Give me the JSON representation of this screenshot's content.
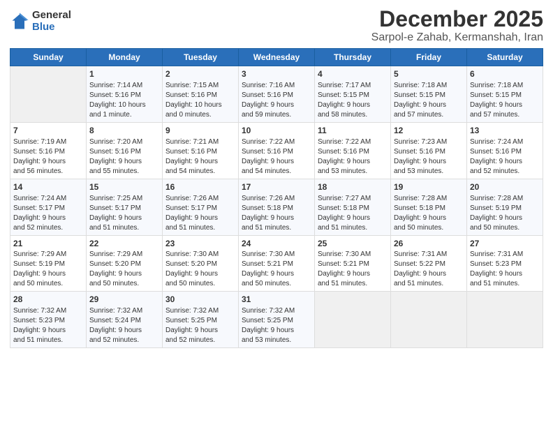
{
  "header": {
    "logo_general": "General",
    "logo_blue": "Blue",
    "month_title": "December 2025",
    "location": "Sarpol-e Zahab, Kermanshah, Iran"
  },
  "days_of_week": [
    "Sunday",
    "Monday",
    "Tuesday",
    "Wednesday",
    "Thursday",
    "Friday",
    "Saturday"
  ],
  "weeks": [
    [
      {
        "day": "",
        "info": ""
      },
      {
        "day": "1",
        "info": "Sunrise: 7:14 AM\nSunset: 5:16 PM\nDaylight: 10 hours\nand 1 minute."
      },
      {
        "day": "2",
        "info": "Sunrise: 7:15 AM\nSunset: 5:16 PM\nDaylight: 10 hours\nand 0 minutes."
      },
      {
        "day": "3",
        "info": "Sunrise: 7:16 AM\nSunset: 5:16 PM\nDaylight: 9 hours\nand 59 minutes."
      },
      {
        "day": "4",
        "info": "Sunrise: 7:17 AM\nSunset: 5:15 PM\nDaylight: 9 hours\nand 58 minutes."
      },
      {
        "day": "5",
        "info": "Sunrise: 7:18 AM\nSunset: 5:15 PM\nDaylight: 9 hours\nand 57 minutes."
      },
      {
        "day": "6",
        "info": "Sunrise: 7:18 AM\nSunset: 5:15 PM\nDaylight: 9 hours\nand 57 minutes."
      }
    ],
    [
      {
        "day": "7",
        "info": "Sunrise: 7:19 AM\nSunset: 5:16 PM\nDaylight: 9 hours\nand 56 minutes."
      },
      {
        "day": "8",
        "info": "Sunrise: 7:20 AM\nSunset: 5:16 PM\nDaylight: 9 hours\nand 55 minutes."
      },
      {
        "day": "9",
        "info": "Sunrise: 7:21 AM\nSunset: 5:16 PM\nDaylight: 9 hours\nand 54 minutes."
      },
      {
        "day": "10",
        "info": "Sunrise: 7:22 AM\nSunset: 5:16 PM\nDaylight: 9 hours\nand 54 minutes."
      },
      {
        "day": "11",
        "info": "Sunrise: 7:22 AM\nSunset: 5:16 PM\nDaylight: 9 hours\nand 53 minutes."
      },
      {
        "day": "12",
        "info": "Sunrise: 7:23 AM\nSunset: 5:16 PM\nDaylight: 9 hours\nand 53 minutes."
      },
      {
        "day": "13",
        "info": "Sunrise: 7:24 AM\nSunset: 5:16 PM\nDaylight: 9 hours\nand 52 minutes."
      }
    ],
    [
      {
        "day": "14",
        "info": "Sunrise: 7:24 AM\nSunset: 5:17 PM\nDaylight: 9 hours\nand 52 minutes."
      },
      {
        "day": "15",
        "info": "Sunrise: 7:25 AM\nSunset: 5:17 PM\nDaylight: 9 hours\nand 51 minutes."
      },
      {
        "day": "16",
        "info": "Sunrise: 7:26 AM\nSunset: 5:17 PM\nDaylight: 9 hours\nand 51 minutes."
      },
      {
        "day": "17",
        "info": "Sunrise: 7:26 AM\nSunset: 5:18 PM\nDaylight: 9 hours\nand 51 minutes."
      },
      {
        "day": "18",
        "info": "Sunrise: 7:27 AM\nSunset: 5:18 PM\nDaylight: 9 hours\nand 51 minutes."
      },
      {
        "day": "19",
        "info": "Sunrise: 7:28 AM\nSunset: 5:18 PM\nDaylight: 9 hours\nand 50 minutes."
      },
      {
        "day": "20",
        "info": "Sunrise: 7:28 AM\nSunset: 5:19 PM\nDaylight: 9 hours\nand 50 minutes."
      }
    ],
    [
      {
        "day": "21",
        "info": "Sunrise: 7:29 AM\nSunset: 5:19 PM\nDaylight: 9 hours\nand 50 minutes."
      },
      {
        "day": "22",
        "info": "Sunrise: 7:29 AM\nSunset: 5:20 PM\nDaylight: 9 hours\nand 50 minutes."
      },
      {
        "day": "23",
        "info": "Sunrise: 7:30 AM\nSunset: 5:20 PM\nDaylight: 9 hours\nand 50 minutes."
      },
      {
        "day": "24",
        "info": "Sunrise: 7:30 AM\nSunset: 5:21 PM\nDaylight: 9 hours\nand 50 minutes."
      },
      {
        "day": "25",
        "info": "Sunrise: 7:30 AM\nSunset: 5:21 PM\nDaylight: 9 hours\nand 51 minutes."
      },
      {
        "day": "26",
        "info": "Sunrise: 7:31 AM\nSunset: 5:22 PM\nDaylight: 9 hours\nand 51 minutes."
      },
      {
        "day": "27",
        "info": "Sunrise: 7:31 AM\nSunset: 5:23 PM\nDaylight: 9 hours\nand 51 minutes."
      }
    ],
    [
      {
        "day": "28",
        "info": "Sunrise: 7:32 AM\nSunset: 5:23 PM\nDaylight: 9 hours\nand 51 minutes."
      },
      {
        "day": "29",
        "info": "Sunrise: 7:32 AM\nSunset: 5:24 PM\nDaylight: 9 hours\nand 52 minutes."
      },
      {
        "day": "30",
        "info": "Sunrise: 7:32 AM\nSunset: 5:25 PM\nDaylight: 9 hours\nand 52 minutes."
      },
      {
        "day": "31",
        "info": "Sunrise: 7:32 AM\nSunset: 5:25 PM\nDaylight: 9 hours\nand 53 minutes."
      },
      {
        "day": "",
        "info": ""
      },
      {
        "day": "",
        "info": ""
      },
      {
        "day": "",
        "info": ""
      }
    ]
  ]
}
